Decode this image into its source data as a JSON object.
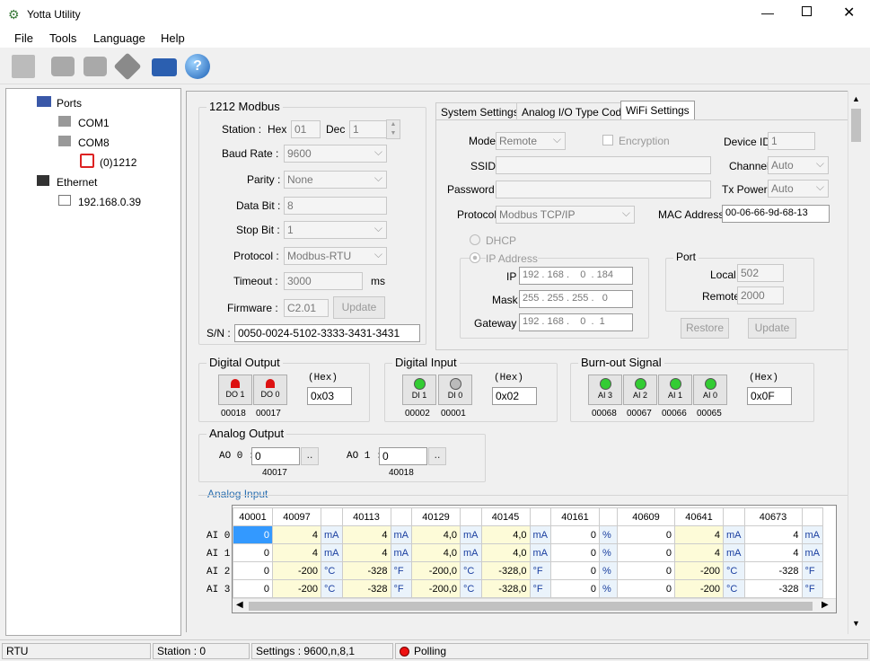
{
  "window": {
    "title": "Yotta Utility"
  },
  "menu": [
    "File",
    "Tools",
    "Language",
    "Help"
  ],
  "tree": {
    "ports": "Ports",
    "com1": "COM1",
    "com8": "COM8",
    "device": "(0)1212",
    "ethernet": "Ethernet",
    "ip": "192.168.0.39"
  },
  "modbus": {
    "title": "1212 Modbus",
    "station_label": "Station :",
    "hex_label": "Hex",
    "hex_value": "01",
    "dec_label": "Dec",
    "dec_value": "1",
    "baud_label": "Baud Rate :",
    "baud_value": "9600",
    "parity_label": "Parity :",
    "parity_value": "None",
    "databit_label": "Data Bit :",
    "databit_value": "8",
    "stopbit_label": "Stop Bit :",
    "stopbit_value": "1",
    "protocol_label": "Protocol :",
    "protocol_value": "Modbus-RTU",
    "timeout_label": "Timeout :",
    "timeout_value": "3000",
    "timeout_unit": "ms",
    "firmware_label": "Firmware :",
    "firmware_value": "C2.01",
    "update_label": "Update",
    "sn_label": "S/N :",
    "sn_value": "0050-0024-5102-3333-3431-3431"
  },
  "tabs": [
    "System Settings",
    "Analog I/O Type Code",
    "WiFi Settings"
  ],
  "wifi": {
    "mode_label": "Mode",
    "mode_value": "Remote",
    "encryption_label": "Encryption",
    "device_id_label": "Device ID",
    "device_id_value": "1",
    "ssid_label": "SSID",
    "ssid_value": "",
    "channel_label": "Channel",
    "channel_value": "Auto",
    "password_label": "Password",
    "password_value": "",
    "txpower_label": "Tx Power",
    "txpower_value": "Auto",
    "protocol_label": "Protocol",
    "protocol_value": "Modbus TCP/IP",
    "mac_label": "MAC Address",
    "mac_value": "00-06-66-9d-68-13",
    "dhcp_label": "DHCP",
    "ipaddr_label": "IP Address",
    "ip_label": "IP",
    "ip": [
      "192",
      "168",
      "0",
      "184"
    ],
    "mask_label": "Mask",
    "mask": [
      "255",
      "255",
      "255",
      "0"
    ],
    "gateway_label": "Gateway",
    "gateway": [
      "192",
      "168",
      "0",
      "1"
    ],
    "port_title": "Port",
    "local_label": "Local",
    "local_value": "502",
    "remote_label": "Remote",
    "remote_value": "2000",
    "restore_label": "Restore",
    "update_label": "Update"
  },
  "digital_output": {
    "title": "Digital Output",
    "hex_label": "(Hex)",
    "hex_value": "0x03",
    "leds": [
      {
        "label": "DO 1",
        "addr": "00018"
      },
      {
        "label": "DO 0",
        "addr": "00017"
      }
    ]
  },
  "digital_input": {
    "title": "Digital Input",
    "hex_label": "(Hex)",
    "hex_value": "0x02",
    "leds": [
      {
        "label": "DI 1",
        "addr": "00002"
      },
      {
        "label": "DI 0",
        "addr": "00001"
      }
    ]
  },
  "burnout": {
    "title": "Burn-out Signal",
    "hex_label": "(Hex)",
    "hex_value": "0x0F",
    "leds": [
      {
        "label": "AI 3",
        "addr": "00068"
      },
      {
        "label": "AI 2",
        "addr": "00067"
      },
      {
        "label": "AI 1",
        "addr": "00066"
      },
      {
        "label": "AI 0",
        "addr": "00065"
      }
    ]
  },
  "analog_output": {
    "title": "Analog Output",
    "ao0_label": "AO 0 :",
    "ao0_value": "0",
    "ao0_addr": "40017",
    "ao1_label": "AO 1 :",
    "ao1_value": "0",
    "ao1_addr": "40018",
    "btn": ".."
  },
  "analog_input": {
    "title": "Analog Input",
    "headers": [
      "40001",
      "40097",
      "",
      "40113",
      "",
      "40129",
      "",
      "40145",
      "",
      "40161",
      "",
      "40609",
      "40641",
      "",
      "40673",
      ""
    ],
    "rows": [
      {
        "label": "AI 0",
        "cells": [
          "0",
          "4",
          "mA",
          "4",
          "mA",
          "4,0",
          "mA",
          "4,0",
          "mA",
          "0",
          "%",
          "0",
          "4",
          "mA",
          "4",
          "mA"
        ]
      },
      {
        "label": "AI 1",
        "cells": [
          "0",
          "4",
          "mA",
          "4",
          "mA",
          "4,0",
          "mA",
          "4,0",
          "mA",
          "0",
          "%",
          "0",
          "4",
          "mA",
          "4",
          "mA"
        ]
      },
      {
        "label": "AI 2",
        "cells": [
          "0",
          "-200",
          "°C",
          "-328",
          "°F",
          "-200,0",
          "°C",
          "-328,0",
          "°F",
          "0",
          "%",
          "0",
          "-200",
          "°C",
          "-328",
          "°F"
        ]
      },
      {
        "label": "AI 3",
        "cells": [
          "0",
          "-200",
          "°C",
          "-328",
          "°F",
          "-200,0",
          "°C",
          "-328,0",
          "°F",
          "0",
          "%",
          "0",
          "-200",
          "°C",
          "-328",
          "°F"
        ]
      }
    ]
  },
  "status": {
    "mode": "RTU",
    "station": "Station : 0",
    "settings": "Settings : 9600,n,8,1",
    "polling": "Polling"
  }
}
